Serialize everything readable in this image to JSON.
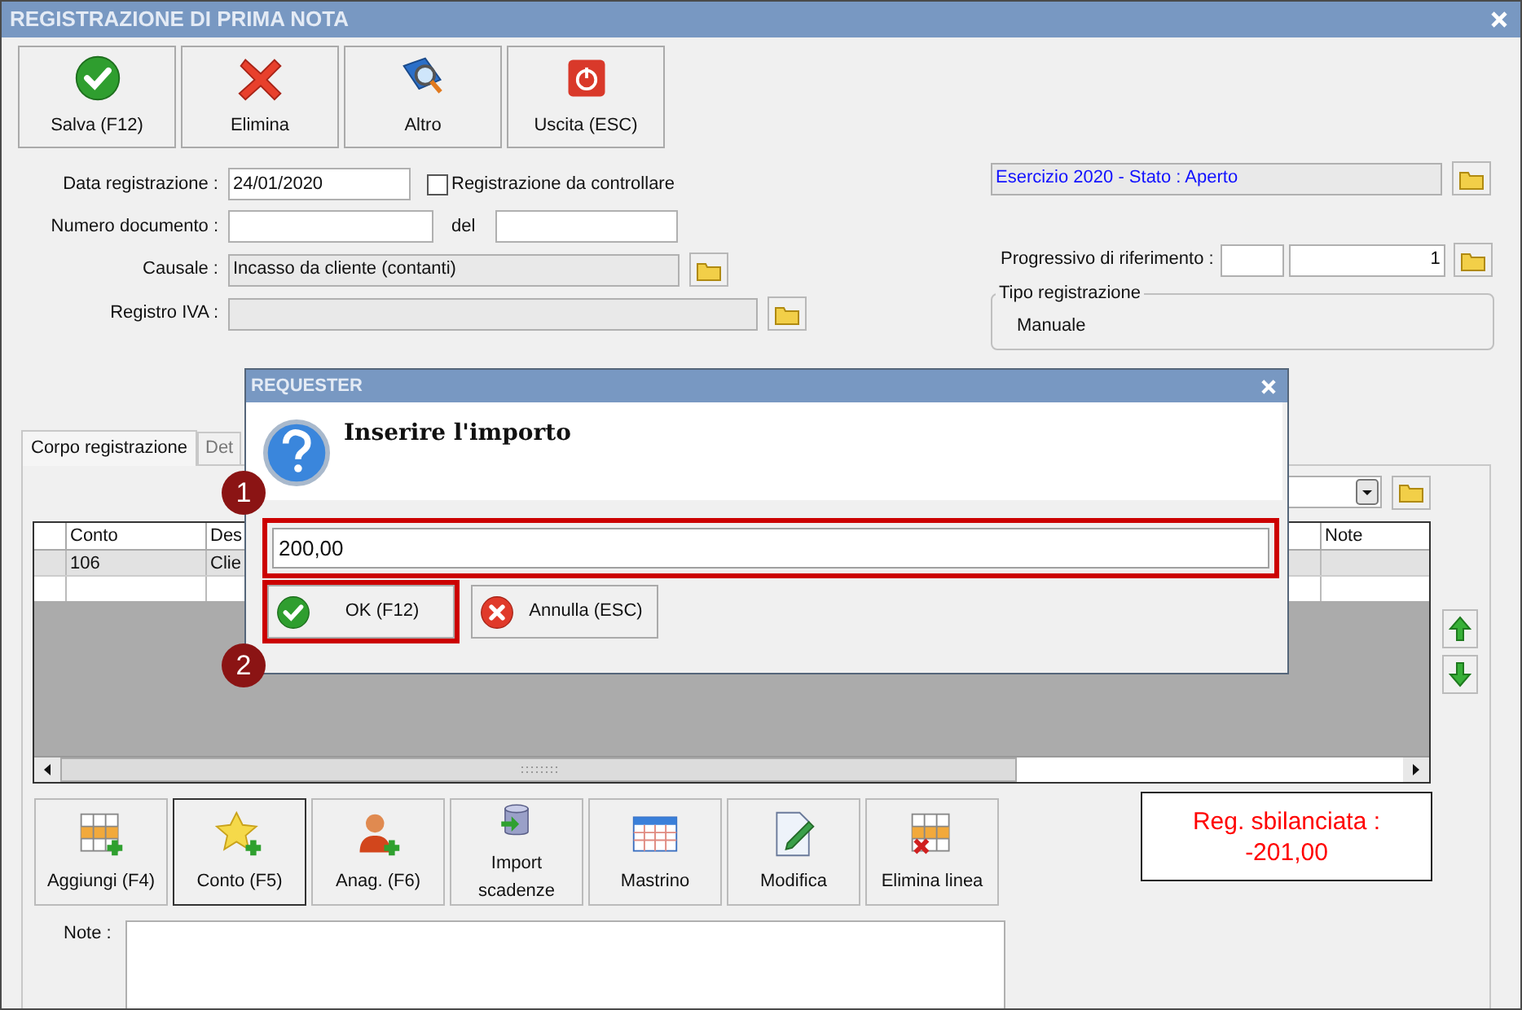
{
  "window": {
    "title": "REGISTRAZIONE DI PRIMA NOTA"
  },
  "toolbar": [
    {
      "label": "Salva (F12)",
      "kind": "save"
    },
    {
      "label": "Elimina",
      "kind": "delete"
    },
    {
      "label": "Altro",
      "kind": "search"
    },
    {
      "label": "Uscita (ESC)",
      "kind": "exit"
    }
  ],
  "form": {
    "data_registrazione": {
      "label": "Data registrazione :",
      "value": "24/01/2020"
    },
    "da_controllare": {
      "label": "Registrazione da controllare",
      "checked": false
    },
    "numero_documento": {
      "label": "Numero documento :"
    },
    "del": {
      "label": "del"
    },
    "causale": {
      "label": "Causale :",
      "value": "Incasso da cliente (contanti)"
    },
    "registro_iva": {
      "label": "Registro IVA :"
    }
  },
  "esercizio": {
    "value": "Esercizio 2020 - Stato : Aperto"
  },
  "progressivo": {
    "label": "Progressivo di riferimento :",
    "value": "1"
  },
  "tipo_registrazione": {
    "legend": "Tipo registrazione",
    "value": "Manuale"
  },
  "tabs": [
    {
      "label": "Corpo registrazione",
      "selected": true
    },
    {
      "label": "Det",
      "selected": false
    }
  ],
  "grid": {
    "columns": [
      "Conto",
      "Des",
      "Note"
    ],
    "rows": [
      {
        "conto": "106",
        "column_2": "Clie",
        "selected": true
      }
    ]
  },
  "bottom_buttons": [
    {
      "label": "Aggiungi (F4)",
      "kind": "add-row",
      "focused": false
    },
    {
      "label": "Conto (F5)",
      "kind": "add-star",
      "focused": true
    },
    {
      "label": "Anag. (F6)",
      "kind": "add-person",
      "focused": false
    },
    {
      "label": "Import scadenze",
      "kind": "database",
      "focused": false
    },
    {
      "label": "Mastrino",
      "kind": "calendar",
      "focused": false
    },
    {
      "label": "Modifica",
      "kind": "edit",
      "focused": false
    },
    {
      "label": "Elimina linea",
      "kind": "remove-row",
      "focused": false
    }
  ],
  "balance": {
    "label": "Reg. sbilanciata :",
    "value": "-201,00"
  },
  "note": {
    "label": "Note :"
  },
  "dialog": {
    "title": "REQUESTER",
    "message": "Inserire l'importo",
    "input": {
      "value": "200,00",
      "highlighted": true
    },
    "buttons": [
      {
        "label": "OK (F12)",
        "kind": "ok",
        "highlighted": true
      },
      {
        "label": "Annulla (ESC)",
        "kind": "cancel",
        "highlighted": false
      }
    ]
  },
  "callouts": [
    {
      "number": "1"
    },
    {
      "number": "2"
    }
  ]
}
